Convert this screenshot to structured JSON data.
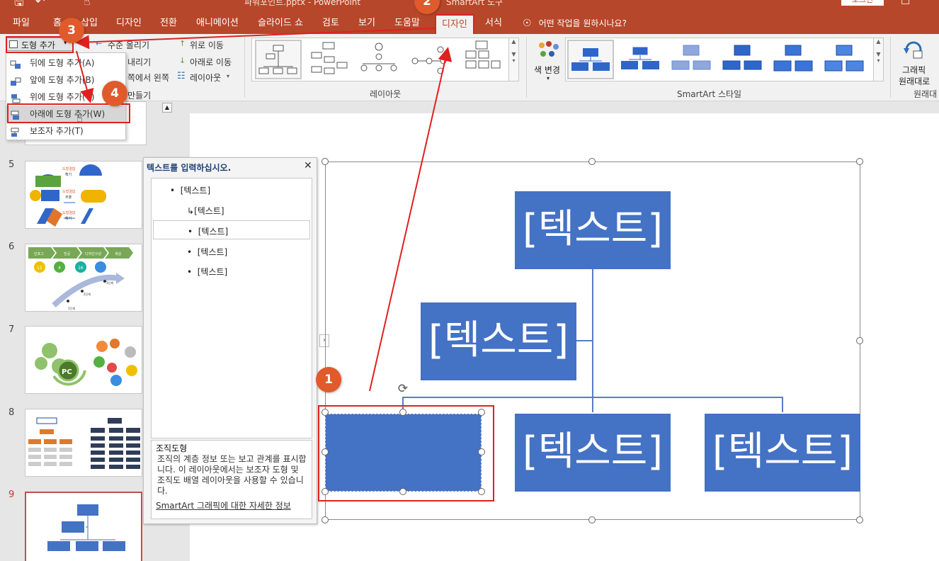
{
  "titlebar": {
    "doc_title": "파워포인트.pptx - PowerPoint",
    "context_title": "SmartArt 도구",
    "login": "로그인"
  },
  "tabs": [
    {
      "label": "파일"
    },
    {
      "label": "홈"
    },
    {
      "label": "삽입"
    },
    {
      "label": "디자인"
    },
    {
      "label": "전환"
    },
    {
      "label": "애니메이션"
    },
    {
      "label": "슬라이드 쇼"
    },
    {
      "label": "검토"
    },
    {
      "label": "보기"
    },
    {
      "label": "도움말"
    },
    {
      "label": "디자인"
    },
    {
      "label": "서식"
    }
  ],
  "tell_me": "어떤 작업을 원하시나요?",
  "ribbon": {
    "add_shape": "도형 추가",
    "promote": "수준 올리기",
    "demote": "내리기",
    "rtl": "쪽에서 왼쪽",
    "create": "만들기",
    "move_up": "위로 이동",
    "move_down": "아래로 이동",
    "layout_btn": "레이아웃",
    "layouts_group": "레이아웃",
    "change_colors": "색 변경",
    "styles_group": "SmartArt 스타일",
    "reset_graphic": "그래픽",
    "reset_graphic2": "원래대로",
    "reset_group": "원래대"
  },
  "dropdown": {
    "items": [
      {
        "label": "뒤에 도형 추가(A)"
      },
      {
        "label": "앞에 도형 추가(B)"
      },
      {
        "label": "위에 도형 추가(V)"
      },
      {
        "label": "아래에 도형 추가(W)"
      },
      {
        "label": "보조자 추가(T)"
      }
    ]
  },
  "slides": {
    "numbers": [
      "5",
      "6",
      "7",
      "8",
      "9"
    ],
    "t5": {
      "a": "도형결합",
      "b": "확기",
      "c": "도형결합",
      "d": "추출",
      "e": "도형결합",
      "f": "확기"
    },
    "t6": {
      "s1": "인포그",
      "s2": "전공",
      "s3": "디자인구성",
      "s4": "색상",
      "c1": "11",
      "c2": "4",
      "c3": "16",
      "l1": "1단계",
      "l2": "2단계",
      "l3": "3단계"
    },
    "t7": {
      "pc": "PC"
    }
  },
  "smartart": {
    "top": "[텍스트]",
    "assistant": "[텍스트]",
    "child2": "[텍스트]",
    "child3": "[텍스트]"
  },
  "textpane": {
    "title": "텍스트를 입력하십시오.",
    "items": [
      "[텍스트]",
      "[텍스트]",
      "[텍스트]",
      "[텍스트]",
      "[텍스트]"
    ],
    "desc_title": "조직도형",
    "desc_body": "조직의 계층 정보 또는 보고 관계를 표시합니다. 이 레이아웃에서는 보조자 도형 및 조직도 배열 레이아웃을 사용할 수 있습니다.",
    "link": "SmartArt 그래픽에 대한 자세한 정보"
  },
  "annotations": [
    "1",
    "2",
    "3",
    "4"
  ],
  "colors": {
    "accent": "#b7472a",
    "shape": "#4472c4",
    "annot": "#e05a2b",
    "frame": "#e02020"
  }
}
